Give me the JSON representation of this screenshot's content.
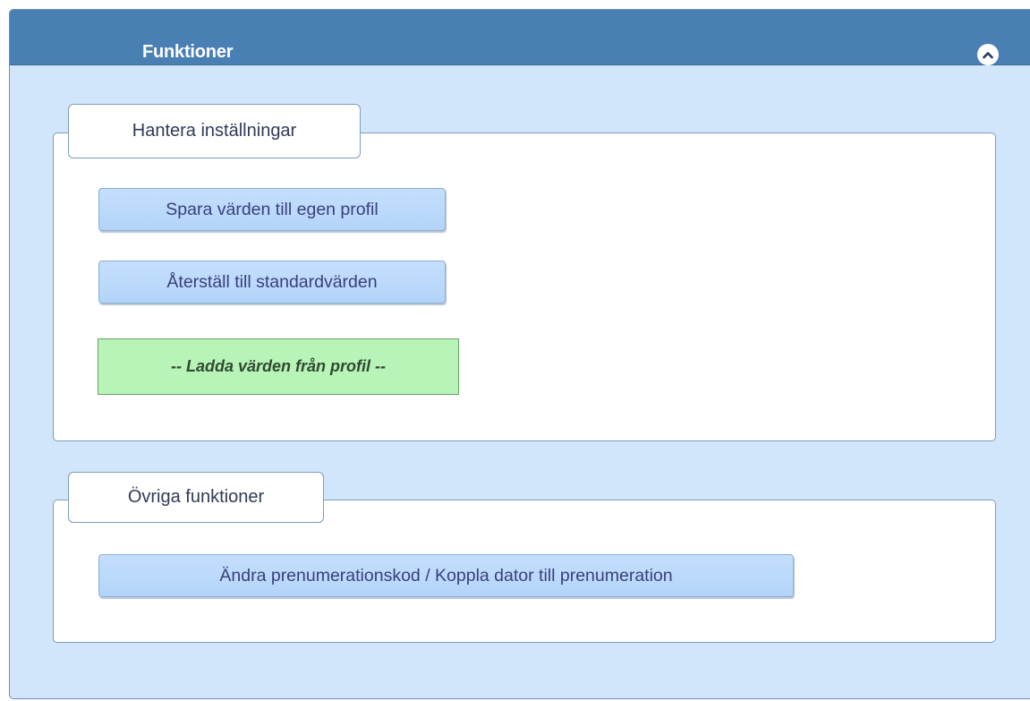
{
  "panel": {
    "title": "Funktioner",
    "collapse_icon": "chevron-up-icon"
  },
  "settings": {
    "legend": "Hantera inställningar",
    "save_label": "Spara värden till egen profil",
    "reset_label": "Återställ till standardvärden",
    "load_profile_label": "-- Ladda värden från profil --"
  },
  "other": {
    "legend": "Övriga funktioner",
    "subscription_label": "Ändra prenumerationskod / Koppla dator till prenumeration"
  },
  "colors": {
    "header": "#4a7fb3",
    "panel_bg": "#d2e6fb",
    "button_bg": "#bcdaf9",
    "button_text": "#3a3f7a",
    "load_bg": "#b8f3b8"
  }
}
